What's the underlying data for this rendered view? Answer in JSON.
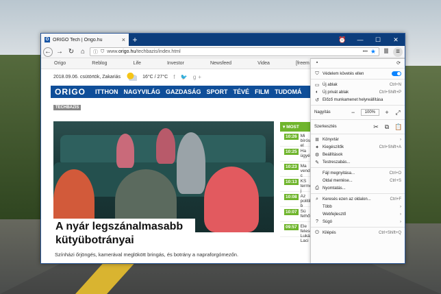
{
  "window": {
    "tab_title": "ORIGO Tech | Origo.hu",
    "favicon": "O",
    "new_tab": "+",
    "min": "—",
    "max": "☐",
    "close": "✕"
  },
  "navbar": {
    "url_prefix": "www.",
    "url_host": "origo.hu",
    "url_path": "/techbazis/index.html",
    "dots": "•••"
  },
  "bookmarks": [
    "Origo",
    "Reblog",
    "Life",
    "Investor",
    "Newsfeed",
    "Videa",
    "[freem"
  ],
  "page": {
    "date": "2018.09.06. csütörtök, Zakariás",
    "weather": "16°C / 27°C",
    "social": "f  🐦  g+",
    "logo": "ORIGO",
    "nav": [
      "ITTHON",
      "NAGYVILÁG",
      "GAZDASÁG",
      "SPORT",
      "TÉVÉ",
      "FILM",
      "TUDOMÁ"
    ],
    "section": "TECHBÁZIS",
    "headline": "A nyár legszánalmasabb kütyübotrányai",
    "subtitle": "Színházi őrjöngés, kamerával meglökött bringás, és botrány a napraforgómezőn.",
    "most_label": "MOST",
    "news": [
      {
        "time": "10:26",
        "text": "Mi bíróság el"
      },
      {
        "time": "10:25",
        "text": "Ha ügyészség"
      },
      {
        "time": "10:23",
        "text": "Ma vendégét c"
      },
      {
        "time": "10:13",
        "text": "KS termelés j"
      },
      {
        "time": "10:08",
        "text": "Az politikai b"
      },
      {
        "time": "10:07",
        "text": "Sú felhőtarb"
      },
      {
        "time": "09:57",
        "text": "Ele feleségét Lukács Laci"
      }
    ]
  },
  "menu": {
    "tracking": "Védelem követés ellen",
    "items_a": [
      {
        "icon": "▭",
        "label": "Új ablak",
        "shortcut": "Ctrl+N"
      },
      {
        "icon": "◐",
        "label": "Új privát ablak",
        "shortcut": "Ctrl+Shift+P"
      },
      {
        "icon": "↺",
        "label": "Előző munkamenet helyreállítása",
        "shortcut": ""
      }
    ],
    "zoom_label": "Nagyítás",
    "zoom_value": "100%",
    "edit_label": "Szerkesztés",
    "items_b": [
      {
        "icon": "Ⅲ",
        "label": "Könyvtár",
        "shortcut": "›"
      },
      {
        "icon": "✦",
        "label": "Kiegészítők",
        "shortcut": "Ctrl+Shift+A"
      },
      {
        "icon": "⚙",
        "label": "Beállítások",
        "shortcut": ""
      },
      {
        "icon": "✎",
        "label": "Testreszabás...",
        "shortcut": ""
      }
    ],
    "items_c": [
      {
        "icon": "",
        "label": "Fájl megnyitása...",
        "shortcut": "Ctrl+O"
      },
      {
        "icon": "",
        "label": "Oldal mentése...",
        "shortcut": "Ctrl+S"
      },
      {
        "icon": "⎙",
        "label": "Nyomtatás...",
        "shortcut": ""
      }
    ],
    "items_d": [
      {
        "icon": "⌕",
        "label": "Keresés ezen az oldalon...",
        "shortcut": "Ctrl+F"
      },
      {
        "icon": "",
        "label": "Több",
        "shortcut": "›"
      },
      {
        "icon": "",
        "label": "Webfejlesztő",
        "shortcut": "›"
      },
      {
        "icon": "?",
        "label": "Súgó",
        "shortcut": "›"
      }
    ],
    "quit": {
      "icon": "⏻",
      "label": "Kilépés",
      "shortcut": "Ctrl+Shift+Q"
    }
  }
}
